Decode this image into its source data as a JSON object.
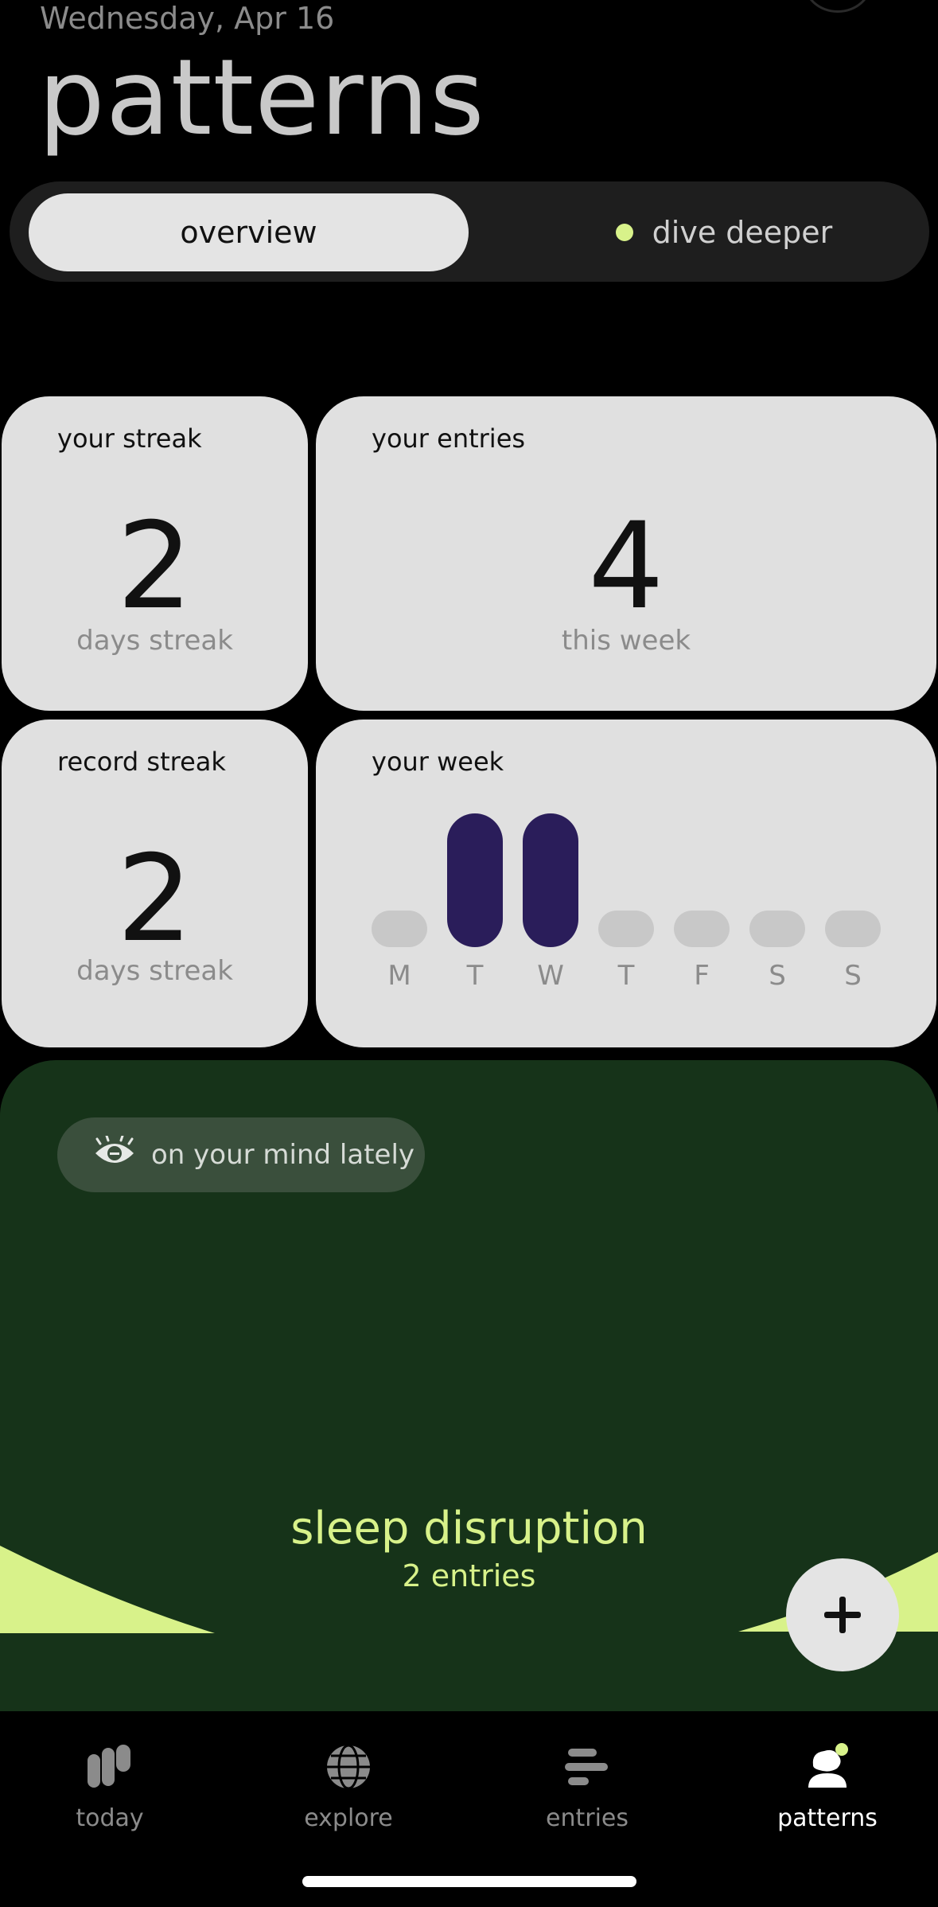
{
  "header": {
    "date": "Wednesday, Apr 16",
    "title": "patterns"
  },
  "segment": {
    "active": "overview",
    "inactive": "dive deeper"
  },
  "cards": {
    "streak": {
      "label": "your streak",
      "value": "2",
      "sub": "days streak"
    },
    "entries": {
      "label": "your entries",
      "value": "4",
      "sub": "this week"
    },
    "record": {
      "label": "record streak",
      "value": "2",
      "sub": "days streak"
    },
    "week": {
      "label": "your week",
      "days": [
        {
          "letter": "M",
          "active": false
        },
        {
          "letter": "T",
          "active": true
        },
        {
          "letter": "W",
          "active": true
        },
        {
          "letter": "T",
          "active": false
        },
        {
          "letter": "F",
          "active": false
        },
        {
          "letter": "S",
          "active": false
        },
        {
          "letter": "S",
          "active": false
        }
      ]
    }
  },
  "mind": {
    "pill_label": "on your mind lately",
    "topic": "sleep disruption",
    "count": "2 entries"
  },
  "tabs": [
    {
      "label": "today",
      "icon": "today-icon",
      "active": false
    },
    {
      "label": "explore",
      "icon": "globe-icon",
      "active": false
    },
    {
      "label": "entries",
      "icon": "entries-icon",
      "active": false
    },
    {
      "label": "patterns",
      "icon": "patterns-icon",
      "active": true
    }
  ],
  "colors": {
    "accent": "#d8f28a",
    "bar_active": "#2a1d5a",
    "bar_inactive": "#c8c8c8",
    "mind_bg": "#163319"
  }
}
